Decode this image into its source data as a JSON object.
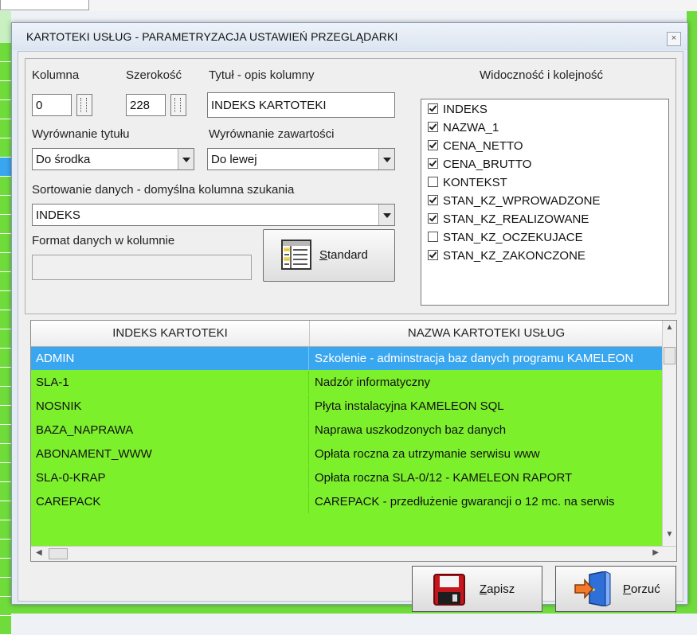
{
  "window": {
    "title": "KARTOTEKI USŁUG - PARAMETRYZACJA USTAWIEŃ PRZEGLĄDARKI",
    "close_label": "×"
  },
  "column_settings": {
    "kolumna_label": "Kolumna",
    "kolumna_value": "0",
    "szerokosc_label": "Szerokość",
    "szerokosc_value": "228",
    "tytul_label": "Tytuł - opis kolumny",
    "tytul_value": "INDEKS KARTOTEKI",
    "wyrownanie_tytulu_label": "Wyrównanie tytułu",
    "wyrownanie_tytulu_value": "Do środka",
    "wyrownanie_zawartosci_label": "Wyrównanie zawartości",
    "wyrownanie_zawartosci_value": "Do lewej",
    "sortowanie_label": "Sortowanie danych - domyślna kolumna szukania",
    "sortowanie_value": "INDEKS",
    "format_label": "Format danych w kolumnie",
    "format_value": "",
    "standard_button_prefix": "S",
    "standard_button_rest": "tandard"
  },
  "visibility": {
    "label": "Widoczność i kolejność",
    "items": [
      {
        "name": "INDEKS",
        "checked": true
      },
      {
        "name": "NAZWA_1",
        "checked": true
      },
      {
        "name": "CENA_NETTO",
        "checked": true
      },
      {
        "name": "CENA_BRUTTO",
        "checked": true
      },
      {
        "name": "KONTEKST",
        "checked": false
      },
      {
        "name": "STAN_KZ_WPROWADZONE",
        "checked": true
      },
      {
        "name": "STAN_KZ_REALIZOWANE",
        "checked": true
      },
      {
        "name": "STAN_KZ_OCZEKUJACE",
        "checked": false
      },
      {
        "name": "STAN_KZ_ZAKONCZONE",
        "checked": true
      }
    ]
  },
  "table": {
    "columns": [
      "INDEKS KARTOTEKI",
      "NAZWA KARTOTEKI USŁUG"
    ],
    "rows": [
      [
        "ADMIN",
        "Szkolenie - adminstracja baz danych programu KAMELEON"
      ],
      [
        "SLA-1",
        "Nadzór informatyczny"
      ],
      [
        "NOSNIK",
        "Płyta instalacyjna KAMELEON SQL"
      ],
      [
        "BAZA_NAPRAWA",
        "Naprawa uszkodzonych baz danych"
      ],
      [
        "ABONAMENT_WWW",
        "Opłata roczna za utrzymanie serwisu www"
      ],
      [
        "SLA-0-KRAP",
        "Opłata roczna SLA-0/12 - KAMELEON RAPORT"
      ],
      [
        "CAREPACK",
        "CAREPACK - przedłużenie gwarancji o 12 mc. na serwis"
      ]
    ],
    "selected_row": 0
  },
  "buttons": {
    "zapisz_prefix": "Z",
    "zapisz_rest": "apisz",
    "porzuc_prefix": "P",
    "porzuc_rest": "orzuć"
  },
  "colors": {
    "row_green": "#7df02c",
    "selected_row": "#39a6f0"
  }
}
